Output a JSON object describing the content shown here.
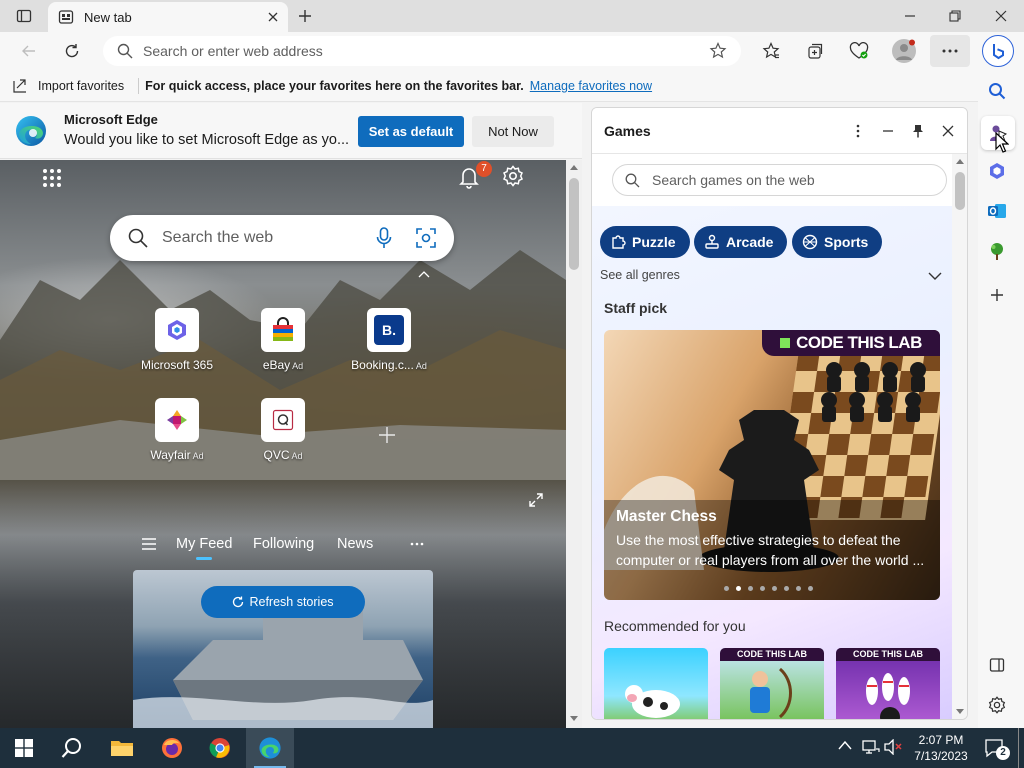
{
  "window": {
    "tab_title": "New tab"
  },
  "toolbar": {
    "address_placeholder": "Search or enter web address"
  },
  "favorites_bar": {
    "import_label": "Import favorites",
    "message": "For quick access, place your favorites here on the favorites bar.",
    "manage_link": "Manage favorites now"
  },
  "banner": {
    "title": "Microsoft Edge",
    "message": "Would you like to set Microsoft Edge as yo...",
    "set_default_label": "Set as default",
    "not_now_label": "Not Now"
  },
  "newtab": {
    "notification_count": "7",
    "search_placeholder": "Search the web",
    "tiles": [
      {
        "name": "Microsoft 365",
        "ad": ""
      },
      {
        "name": "eBay",
        "ad": "Ad"
      },
      {
        "name": "Booking.c...",
        "ad": "Ad"
      },
      {
        "name": "Wayfair",
        "ad": "Ad"
      },
      {
        "name": "QVC",
        "ad": "Ad"
      }
    ],
    "feed_tabs": [
      "My Feed",
      "Following",
      "News"
    ],
    "refresh_label": "Refresh stories"
  },
  "games": {
    "title": "Games",
    "search_placeholder": "Search games on the web",
    "genres": [
      "Puzzle",
      "Arcade",
      "Sports"
    ],
    "see_all": "See all genres",
    "staff_pick_heading": "Staff pick",
    "staff_pick": {
      "brand": "CODE THIS LAB",
      "title": "Master Chess",
      "description": "Use the most effective strategies to defeat the computer or real players from all over the world ..."
    },
    "recommended_heading": "Recommended for you",
    "recommended_brand": "CODE THIS LAB"
  },
  "taskbar": {
    "time": "2:07 PM",
    "date": "7/13/2023",
    "notification_count": "2"
  },
  "colors": {
    "accent": "#0f6cbd",
    "genre_pill": "#0f3e83",
    "taskbar": "#1e2f3c"
  }
}
